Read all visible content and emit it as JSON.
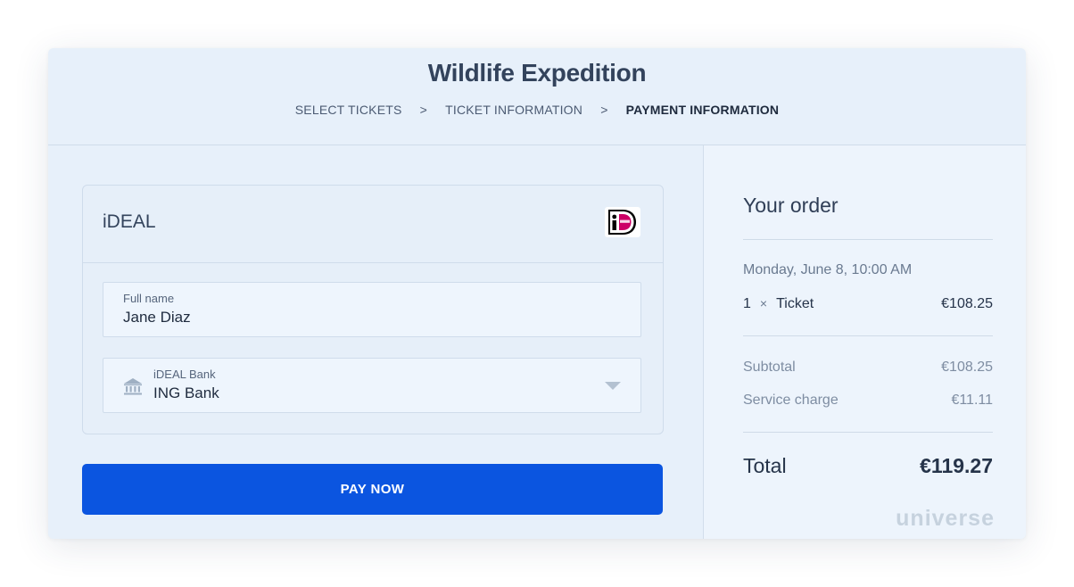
{
  "header": {
    "title": "Wildlife Expedition",
    "breadcrumbs": [
      {
        "label": "SELECT TICKETS"
      },
      {
        "label": "TICKET INFORMATION"
      },
      {
        "label": "PAYMENT INFORMATION"
      }
    ],
    "separator": ">"
  },
  "payment": {
    "method_label": "iDEAL",
    "fields": {
      "full_name": {
        "label": "Full name",
        "value": "Jane Diaz"
      },
      "bank": {
        "label": "iDEAL Bank",
        "value": "ING Bank"
      }
    },
    "pay_button_label": "PAY NOW"
  },
  "order": {
    "title": "Your order",
    "date": "Monday, June 8, 10:00 AM",
    "items": [
      {
        "quantity": "1",
        "times": "×",
        "name": "Ticket",
        "price": "€108.25"
      }
    ],
    "subtotal_label": "Subtotal",
    "subtotal_value": "€108.25",
    "service_label": "Service charge",
    "service_value": "€11.11",
    "total_label": "Total",
    "total_value": "€119.27",
    "brand": "universe"
  },
  "icons": {
    "ideal_logo": "ideal-logo-icon",
    "bank": "bank-icon",
    "dropdown": "chevron-down-icon",
    "breadcrumb_separator": "chevron-right-icon"
  },
  "colors": {
    "accent": "#0b55e0",
    "ideal_pink": "#cc0066",
    "background": "#e7f0fa"
  }
}
